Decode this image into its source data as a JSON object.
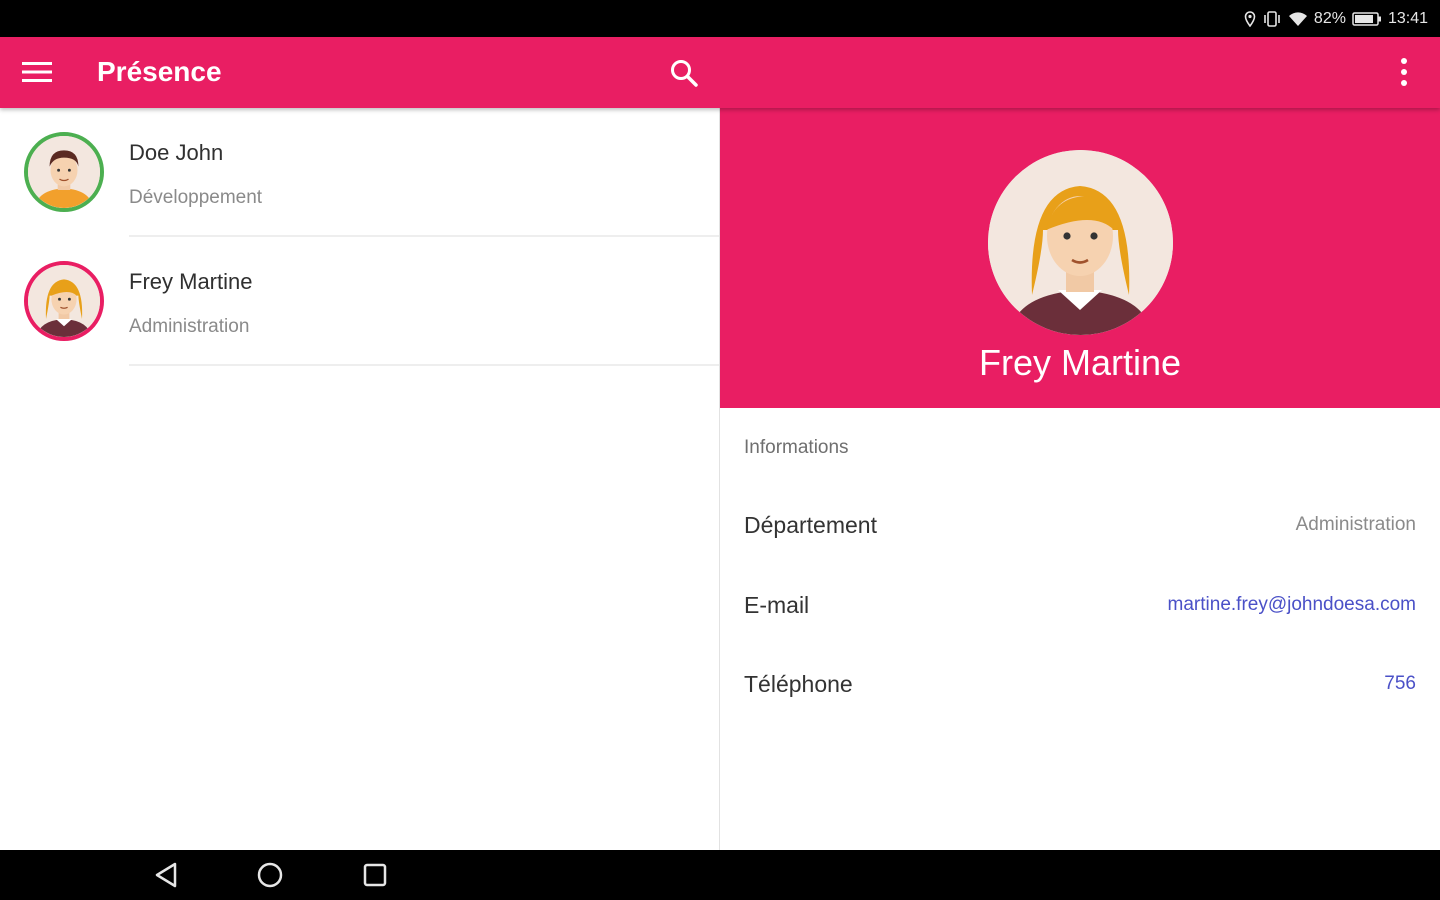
{
  "status_bar": {
    "battery": "82%",
    "time": "13:41"
  },
  "app_bar": {
    "title": "Présence",
    "menu_icon": "hamburger-menu-icon",
    "search_icon": "search-icon",
    "overflow_icon": "more-vertical-icon"
  },
  "contacts": [
    {
      "name": "Doe John",
      "department": "Développement",
      "status_color": "#4caf50"
    },
    {
      "name": "Frey Martine",
      "department": "Administration",
      "status_color": "#e91e63"
    }
  ],
  "detail": {
    "name": "Frey Martine",
    "section_label": "Informations",
    "rows": [
      {
        "key": "Département",
        "value": "Administration"
      },
      {
        "key": "E-mail",
        "value": "martine.frey@johndoesa.com"
      },
      {
        "key": "Téléphone",
        "value": "756"
      }
    ]
  },
  "colors": {
    "accent": "#e91e63",
    "link": "#4a50c7"
  },
  "nav_bar": {
    "back_icon": "back-triangle-icon",
    "home_icon": "home-circle-icon",
    "recents_icon": "recents-square-icon"
  }
}
